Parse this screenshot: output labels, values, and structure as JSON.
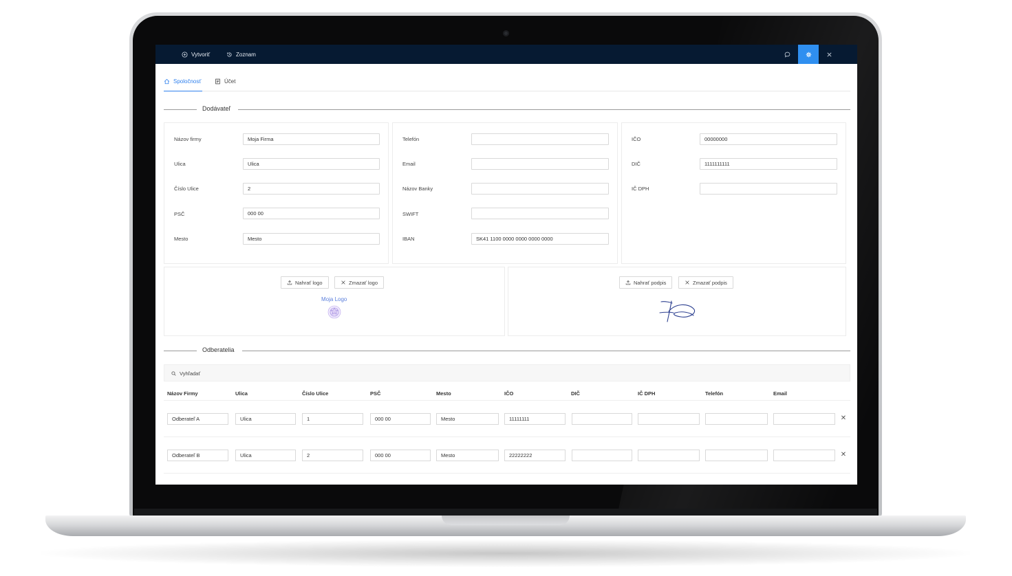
{
  "topbar": {
    "create_label": "Vytvoriť",
    "list_label": "Zoznam"
  },
  "tabs": [
    {
      "label": "Spoločnosť",
      "active": true
    },
    {
      "label": "Účet",
      "active": false
    }
  ],
  "supplier": {
    "section_title": "Dodávateľ",
    "col1": [
      {
        "label": "Názov firmy",
        "value": "Moja Firma"
      },
      {
        "label": "Ulica",
        "value": "Ulica"
      },
      {
        "label": "Číslo Ulice",
        "value": "2"
      },
      {
        "label": "PSČ",
        "value": "000 00"
      },
      {
        "label": "Mesto",
        "value": "Mesto"
      }
    ],
    "col2": [
      {
        "label": "Telefón",
        "value": ""
      },
      {
        "label": "Email",
        "value": ""
      },
      {
        "label": "Názov Banky",
        "value": ""
      },
      {
        "label": "SWIFT",
        "value": ""
      },
      {
        "label": "IBAN",
        "value": "SK41 1100 0000 0000 0000 0000"
      }
    ],
    "col3": [
      {
        "label": "IČO",
        "value": "00000000"
      },
      {
        "label": "DIČ",
        "value": "1111111111"
      },
      {
        "label": "IČ DPH",
        "value": ""
      }
    ],
    "upload_logo_label": "Nahrať logo",
    "delete_logo_label": "Zmazať logo",
    "logo_text": "Moja Logo",
    "upload_signature_label": "Nahrať podpis",
    "delete_signature_label": "Zmazať podpis"
  },
  "customers": {
    "section_title": "Odberatelia",
    "search_placeholder": "Vyhľadať",
    "columns": [
      "Názov Firmy",
      "Ulica",
      "Číslo Ulice",
      "PSČ",
      "Mesto",
      "IČO",
      "DIČ",
      "IČ DPH",
      "Telefón",
      "Email"
    ],
    "rows": [
      [
        "Odberateľ A",
        "Ulica",
        "1",
        "000 00",
        "Mesto",
        "11111111",
        "",
        "",
        "",
        ""
      ],
      [
        "Odberateľ B",
        "Ulica",
        "2",
        "000 00",
        "Mesto",
        "22222222",
        "",
        "",
        "",
        ""
      ]
    ],
    "remove_symbol": "✕"
  },
  "colors": {
    "topbar_bg": "#061a32",
    "accent": "#2f80ed",
    "settings_active": "#2f8ff0"
  }
}
